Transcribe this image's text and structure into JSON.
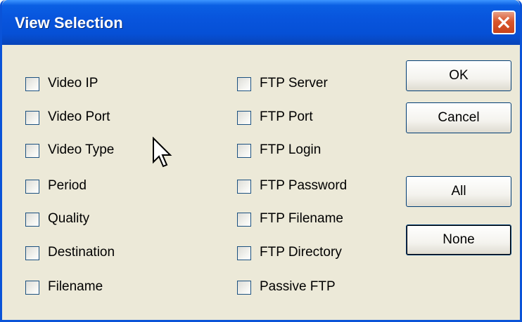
{
  "window": {
    "title": "View Selection",
    "close_icon": "close-icon"
  },
  "checkboxes_left": [
    {
      "label": "Video IP",
      "checked": false
    },
    {
      "label": "Video Port",
      "checked": false
    },
    {
      "label": "Video Type",
      "checked": false
    },
    {
      "label": "Period",
      "checked": false
    },
    {
      "label": "Quality",
      "checked": false
    },
    {
      "label": "Destination",
      "checked": false
    },
    {
      "label": "Filename",
      "checked": false
    }
  ],
  "checkboxes_right": [
    {
      "label": "FTP Server",
      "checked": false
    },
    {
      "label": "FTP Port",
      "checked": false
    },
    {
      "label": "FTP Login",
      "checked": false
    },
    {
      "label": "FTP Password",
      "checked": false
    },
    {
      "label": "FTP Filename",
      "checked": false
    },
    {
      "label": "FTP Directory",
      "checked": false
    },
    {
      "label": "Passive FTP",
      "checked": false
    }
  ],
  "buttons": {
    "ok": "OK",
    "cancel": "Cancel",
    "all": "All",
    "none": "None"
  },
  "colors": {
    "titlebar": "#0855dd",
    "dialog_bg": "#ece9d8",
    "close_button": "#d9562c"
  }
}
